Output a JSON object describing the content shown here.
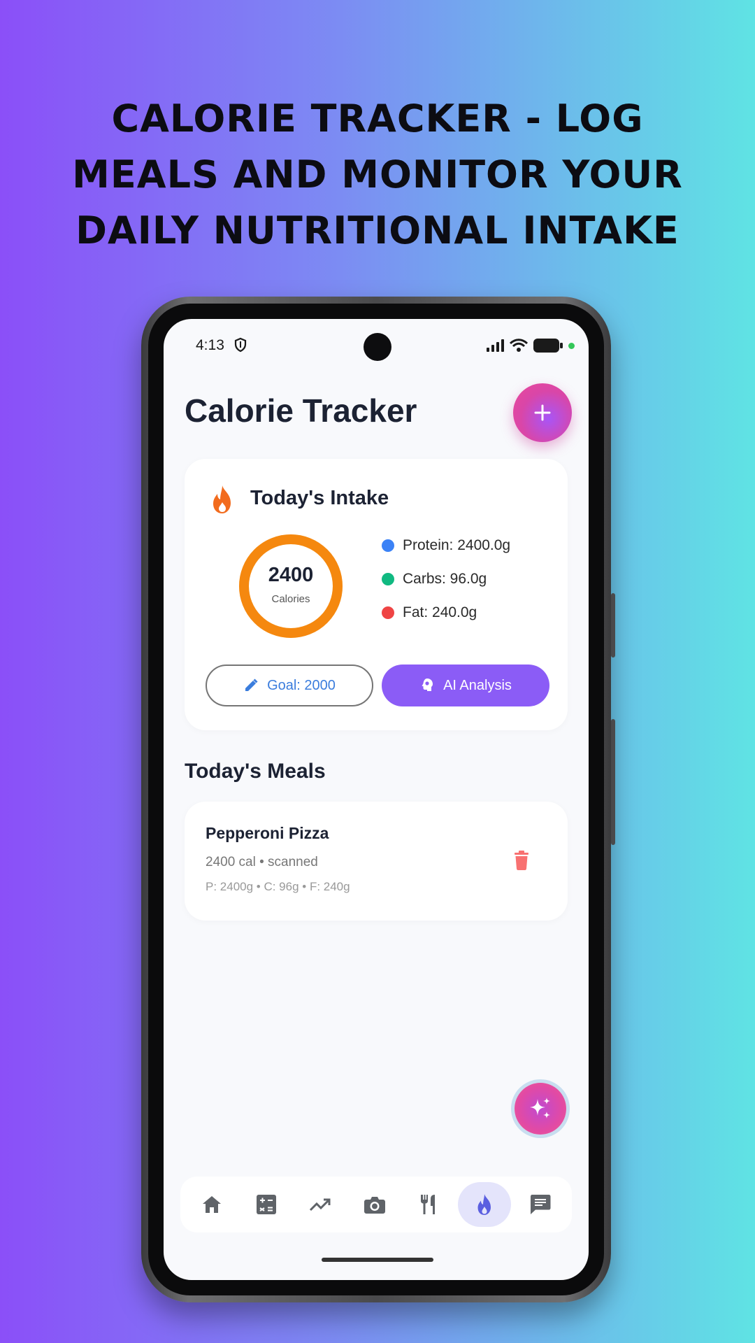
{
  "headline": {
    "line1": "CALORIE TRACKER - LOG",
    "line2": "MEALS AND MONITOR YOUR",
    "line3": "DAILY NUTRITIONAL INTAKE"
  },
  "status_bar": {
    "time": "4:13"
  },
  "app": {
    "title": "Calorie Tracker",
    "add_button_icon": "plus-icon"
  },
  "intake": {
    "title": "Today's Intake",
    "calories": "2400",
    "calories_label": "Calories",
    "progress_fraction": 1.0,
    "macros": [
      {
        "label": "Protein: 2400.0g",
        "color": "#3b82f6"
      },
      {
        "label": "Carbs: 96.0g",
        "color": "#10b981"
      },
      {
        "label": "Fat: 240.0g",
        "color": "#ef4444"
      }
    ],
    "goal_button": "Goal: 2000",
    "ai_button": "AI Analysis"
  },
  "meals": {
    "title": "Today's Meals",
    "items": [
      {
        "name": "Pepperoni Pizza",
        "meta": "2400 cal • scanned",
        "macros": "P: 2400g • C: 96g • F: 240g"
      }
    ]
  },
  "nav": {
    "items": [
      "home-icon",
      "calculator-icon",
      "trending-up-icon",
      "camera-icon",
      "restaurant-icon",
      "fire-icon",
      "chat-icon"
    ],
    "active": "fire-icon"
  },
  "colors": {
    "accent": "#8b5cf6",
    "ring": "#f5880f",
    "goal_text": "#3b7ddd",
    "trash": "#f87171"
  }
}
